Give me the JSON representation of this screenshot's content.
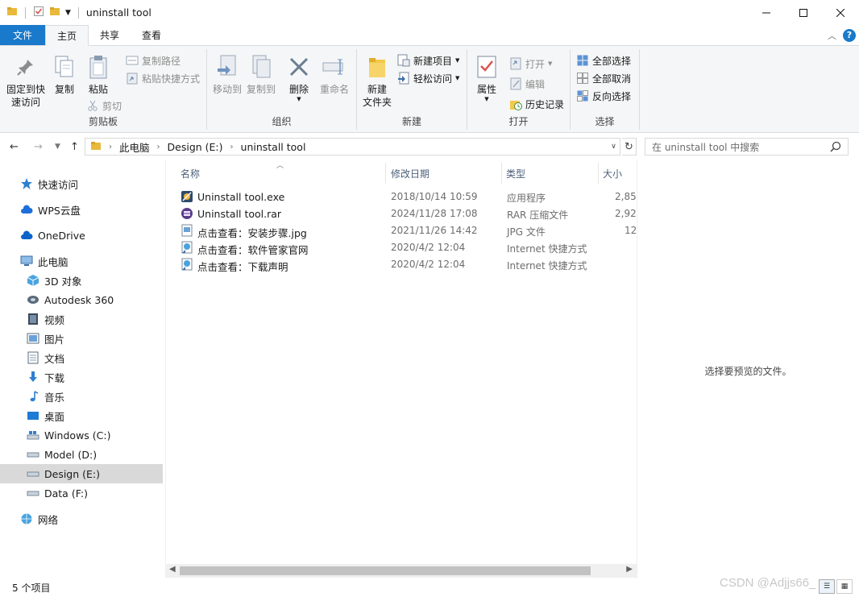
{
  "window": {
    "title": "uninstall tool"
  },
  "tabs": {
    "file": "文件",
    "home": "主页",
    "share": "共享",
    "view": "查看"
  },
  "ribbon": {
    "clipboard": {
      "label": "剪贴板",
      "pin": "固定到快\n速访问",
      "copy": "复制",
      "paste": "粘贴",
      "copy_path": "复制路径",
      "paste_shortcut": "粘贴快捷方式",
      "cut": "剪切"
    },
    "organize": {
      "label": "组织",
      "move_to": "移动到",
      "copy_to": "复制到",
      "delete": "删除",
      "rename": "重命名"
    },
    "new": {
      "label": "新建",
      "new_folder": "新建\n文件夹",
      "new_item": "新建项目",
      "easy_access": "轻松访问"
    },
    "open": {
      "label": "打开",
      "properties": "属性",
      "open": "打开",
      "edit": "编辑",
      "history": "历史记录"
    },
    "select": {
      "label": "选择",
      "select_all": "全部选择",
      "select_none": "全部取消",
      "invert": "反向选择"
    }
  },
  "address": {
    "crumbs": [
      "此电脑",
      "Design (E:)",
      "uninstall tool"
    ],
    "search_placeholder": "在 uninstall tool 中搜索"
  },
  "nav": {
    "quick_access": "快速访问",
    "wps": "WPS云盘",
    "onedrive": "OneDrive",
    "this_pc": "此电脑",
    "objects3d": "3D 对象",
    "autodesk": "Autodesk 360",
    "videos": "视频",
    "pictures": "图片",
    "documents": "文档",
    "downloads": "下载",
    "music": "音乐",
    "desktop": "桌面",
    "drive_c": "Windows (C:)",
    "drive_d": "Model (D:)",
    "drive_e": "Design (E:)",
    "drive_f": "Data (F:)",
    "network": "网络"
  },
  "columns": {
    "name": "名称",
    "date": "修改日期",
    "type": "类型",
    "size": "大小"
  },
  "files": [
    {
      "name": "Uninstall tool.exe",
      "date": "2018/10/14 10:59",
      "type": "应用程序",
      "size": "2,85"
    },
    {
      "name": "Uninstall tool.rar",
      "date": "2024/11/28 17:08",
      "type": "RAR 压缩文件",
      "size": "2,92"
    },
    {
      "name": "点击查看：安装步骤.jpg",
      "date": "2021/11/26 14:42",
      "type": "JPG 文件",
      "size": "12"
    },
    {
      "name": "点击查看：软件管家官网",
      "date": "2020/4/2 12:04",
      "type": "Internet 快捷方式",
      "size": ""
    },
    {
      "name": "点击查看：下载声明",
      "date": "2020/4/2 12:04",
      "type": "Internet 快捷方式",
      "size": ""
    }
  ],
  "preview": {
    "message": "选择要预览的文件。"
  },
  "status": {
    "count": "5 个项目"
  },
  "watermark": "CSDN @Adjjs66_"
}
